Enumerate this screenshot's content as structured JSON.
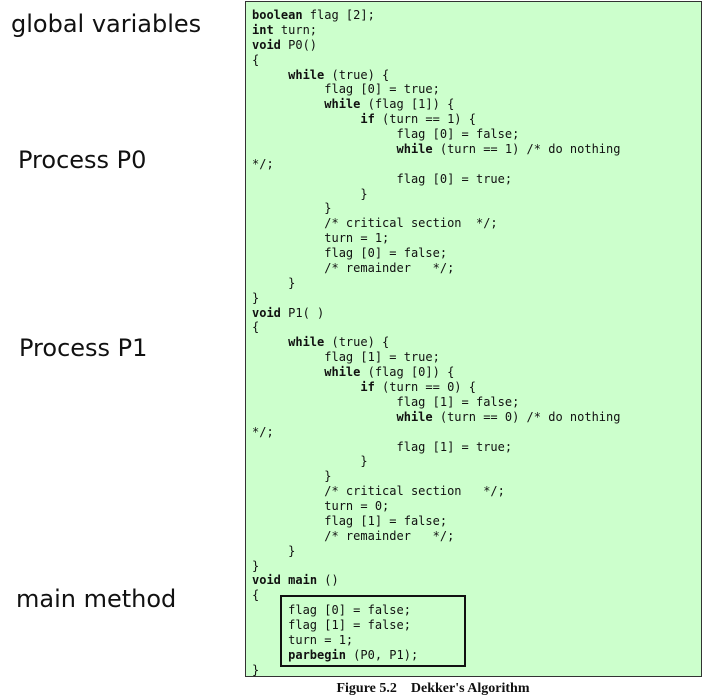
{
  "labels": {
    "globals": "global variables",
    "p0": "Process P0",
    "p1": "Process P1",
    "main": "main method"
  },
  "code": [
    {
      "s": [
        {
          "k": 1,
          "t": "boolean"
        },
        {
          "t": " flag [2];"
        }
      ]
    },
    {
      "s": [
        {
          "k": 1,
          "t": "int"
        },
        {
          "t": " turn;"
        }
      ]
    },
    {
      "s": [
        {
          "k": 1,
          "t": "void"
        },
        {
          "t": " P0()"
        }
      ]
    },
    {
      "s": [
        {
          "t": "{"
        }
      ]
    },
    {
      "s": [
        {
          "t": "     "
        },
        {
          "k": 1,
          "t": "while"
        },
        {
          "t": " (true) {"
        }
      ]
    },
    {
      "s": [
        {
          "t": "          flag [0] = true;"
        }
      ]
    },
    {
      "s": [
        {
          "t": "          "
        },
        {
          "k": 1,
          "t": "while"
        },
        {
          "t": " (flag [1]) {"
        }
      ]
    },
    {
      "s": [
        {
          "t": "               "
        },
        {
          "k": 1,
          "t": "if"
        },
        {
          "t": " (turn == 1) {"
        }
      ]
    },
    {
      "s": [
        {
          "t": "                    flag [0] = false;"
        }
      ]
    },
    {
      "s": [
        {
          "t": "                    "
        },
        {
          "k": 1,
          "t": "while"
        },
        {
          "t": " (turn == 1) /* do nothing"
        }
      ]
    },
    {
      "s": [
        {
          "t": "*/;"
        }
      ]
    },
    {
      "s": [
        {
          "t": "                    flag [0] = true;"
        }
      ]
    },
    {
      "s": [
        {
          "t": "               }"
        }
      ]
    },
    {
      "s": [
        {
          "t": "          }"
        }
      ]
    },
    {
      "s": [
        {
          "t": "          /* critical section  */;"
        }
      ]
    },
    {
      "s": [
        {
          "t": "          turn = 1;"
        }
      ]
    },
    {
      "s": [
        {
          "t": "          flag [0] = false;"
        }
      ]
    },
    {
      "s": [
        {
          "t": "          /* remainder   */;"
        }
      ]
    },
    {
      "s": [
        {
          "t": "     }"
        }
      ]
    },
    {
      "s": [
        {
          "t": "}"
        }
      ]
    },
    {
      "s": [
        {
          "k": 1,
          "t": "void"
        },
        {
          "t": " P1( )"
        }
      ]
    },
    {
      "s": [
        {
          "t": "{"
        }
      ]
    },
    {
      "s": [
        {
          "t": "     "
        },
        {
          "k": 1,
          "t": "while"
        },
        {
          "t": " (true) {"
        }
      ]
    },
    {
      "s": [
        {
          "t": "          flag [1] = true;"
        }
      ]
    },
    {
      "s": [
        {
          "t": "          "
        },
        {
          "k": 1,
          "t": "while"
        },
        {
          "t": " (flag [0]) {"
        }
      ]
    },
    {
      "s": [
        {
          "t": "               "
        },
        {
          "k": 1,
          "t": "if"
        },
        {
          "t": " (turn == 0) {"
        }
      ]
    },
    {
      "s": [
        {
          "t": "                    flag [1] = false;"
        }
      ]
    },
    {
      "s": [
        {
          "t": "                    "
        },
        {
          "k": 1,
          "t": "while"
        },
        {
          "t": " (turn == 0) /* do nothing"
        }
      ]
    },
    {
      "s": [
        {
          "t": "*/;"
        }
      ]
    },
    {
      "s": [
        {
          "t": "                    flag [1] = true;"
        }
      ]
    },
    {
      "s": [
        {
          "t": "               }"
        }
      ]
    },
    {
      "s": [
        {
          "t": "          }"
        }
      ]
    },
    {
      "s": [
        {
          "t": "          /* critical section   */;"
        }
      ]
    },
    {
      "s": [
        {
          "t": "          turn = 0;"
        }
      ]
    },
    {
      "s": [
        {
          "t": "          flag [1] = false;"
        }
      ]
    },
    {
      "s": [
        {
          "t": "          /* remainder   */;"
        }
      ]
    },
    {
      "s": [
        {
          "t": "     }"
        }
      ]
    },
    {
      "s": [
        {
          "t": "}"
        }
      ]
    },
    {
      "s": [
        {
          "k": 1,
          "t": "void"
        },
        {
          "t": " "
        },
        {
          "k": 1,
          "t": "main"
        },
        {
          "t": " ()"
        }
      ]
    },
    {
      "s": [
        {
          "t": "{"
        }
      ]
    },
    {
      "s": [
        {
          "t": "     flag [0] = false;"
        }
      ]
    },
    {
      "s": [
        {
          "t": "     flag [1] = false;"
        }
      ]
    },
    {
      "s": [
        {
          "t": "     turn = 1;"
        }
      ]
    },
    {
      "s": [
        {
          "t": "     "
        },
        {
          "k": 1,
          "t": "parbegin"
        },
        {
          "t": " (P0, P1);"
        }
      ]
    },
    {
      "s": [
        {
          "t": "}"
        }
      ]
    }
  ],
  "caption": "Figure 5.2    Dekker's Algorithm",
  "colors": {
    "panel_background": "#ccffcc",
    "text": "#111111"
  }
}
